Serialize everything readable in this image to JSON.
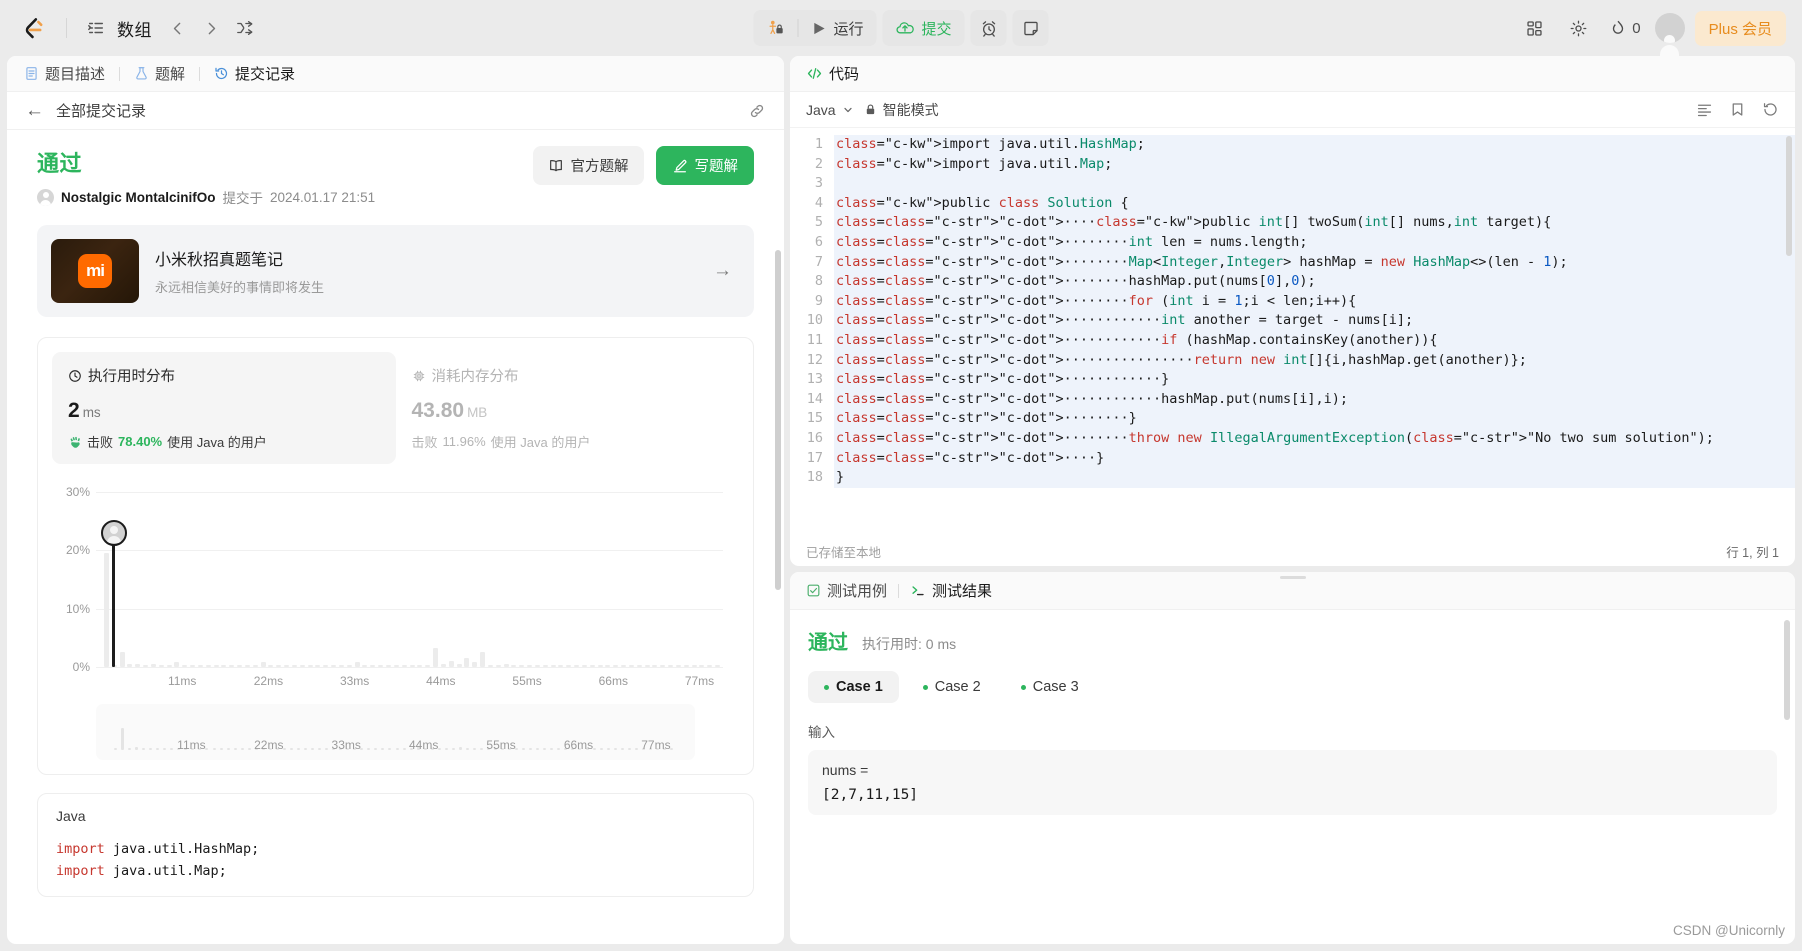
{
  "topbar": {
    "logo_icon": "leetcode-logo-icon",
    "list_icon": "list-icon",
    "title": "数组",
    "prev_icon": "chevron-left-icon",
    "next_icon": "chevron-right-icon",
    "shuffle_icon": "shuffle-icon",
    "debug_icon": "debug-lock-icon",
    "run_icon": "play-icon",
    "run_label": "运行",
    "submit_icon": "cloud-upload-icon",
    "submit_label": "提交",
    "timer_icon": "alarm-clock-icon",
    "note_icon": "note-icon",
    "apps_icon": "grid-apps-icon",
    "settings_icon": "gear-icon",
    "streak_icon": "flame-icon",
    "streak_count": "0",
    "avatar": "user-avatar",
    "plus_label": "Plus 会员"
  },
  "left_panel": {
    "tabs": [
      {
        "label": "题目描述",
        "icon": "document-icon",
        "active": false
      },
      {
        "label": "题解",
        "icon": "flask-icon",
        "active": false
      },
      {
        "label": "提交记录",
        "icon": "history-icon",
        "active": true
      }
    ],
    "back_label": "全部提交记录",
    "back_icon": "arrow-left-icon",
    "link_icon": "link-icon",
    "submission": {
      "verdict": "通过",
      "user": "Nostalgic MontalcinifOo",
      "submitted_prefix": "提交于",
      "timestamp": "2024.01.17 21:51",
      "official_solution_label": "官方题解",
      "official_solution_icon": "book-icon",
      "write_solution_label": "写题解",
      "write_solution_icon": "pencil-icon"
    },
    "ad": {
      "logo_text": "mi",
      "title": "小米秋招真题笔记",
      "subtitle": "永远相信美好的事情即将发生",
      "arrow_icon": "arrow-right-icon"
    },
    "stats": {
      "runtime": {
        "icon": "clock-icon",
        "title": "执行用时分布",
        "value": "2",
        "unit": "ms",
        "beat_icon": "hand-clap-icon",
        "beat_prefix": "击败",
        "beat_pct": "78.40%",
        "beat_suffix": "使用 Java 的用户"
      },
      "memory": {
        "icon": "chip-icon",
        "title": "消耗内存分布",
        "value": "43.80",
        "unit": "MB",
        "beat_prefix": "击败",
        "beat_pct": "11.96%",
        "beat_suffix": "使用 Java 的用户"
      }
    },
    "code_card": {
      "lang": "Java",
      "lines": [
        "import java.util.HashMap;",
        "import java.util.Map;"
      ]
    }
  },
  "chart_data": {
    "type": "bar",
    "title": "执行用时分布",
    "xlabel": "",
    "ylabel": "",
    "ylim": [
      0,
      30
    ],
    "yticks": [
      "0%",
      "10%",
      "20%",
      "30%"
    ],
    "ytick_values": [
      0,
      10,
      20,
      30
    ],
    "xticks": [
      "11ms",
      "22ms",
      "33ms",
      "44ms",
      "55ms",
      "66ms",
      "77ms"
    ],
    "xtick_values": [
      11,
      22,
      33,
      44,
      55,
      66,
      77
    ],
    "grid": true,
    "legend": "none",
    "marker": {
      "x": 2,
      "y": 24.5,
      "label": "2 ms",
      "beat": "78.40%"
    },
    "categories": [
      1,
      2,
      3,
      4,
      5,
      6,
      7,
      8,
      9,
      10,
      11,
      12,
      13,
      14,
      15,
      16,
      17,
      18,
      19,
      20,
      21,
      22,
      23,
      24,
      25,
      26,
      27,
      28,
      29,
      30,
      31,
      32,
      33,
      34,
      35,
      36,
      37,
      38,
      39,
      40,
      41,
      42,
      43,
      44,
      45,
      46,
      47,
      48,
      49,
      50,
      51,
      52,
      53,
      54,
      55,
      56,
      57,
      58,
      59,
      60,
      61,
      62,
      63,
      64,
      65,
      66,
      67,
      68,
      69,
      70,
      71,
      72,
      73,
      74,
      75,
      76,
      77,
      78,
      79,
      80
    ],
    "values": [
      0,
      19.5,
      0.3,
      2.6,
      0.5,
      0.6,
      0.4,
      0.5,
      0.4,
      0.4,
      0.9,
      0.4,
      0.3,
      0.3,
      0.3,
      0.3,
      0.3,
      0.3,
      0.3,
      0.3,
      0.3,
      0.9,
      0.3,
      0.3,
      0.3,
      0.3,
      0.3,
      0.3,
      0.3,
      0.3,
      0.3,
      0.3,
      0.3,
      0.9,
      0.3,
      0.3,
      0.3,
      0.3,
      0.3,
      0.3,
      0.3,
      0.3,
      0.3,
      3.3,
      0.6,
      1.0,
      0.5,
      1.6,
      0.8,
      2.6,
      0.4,
      0.4,
      0.5,
      0.3,
      0.4,
      0.3,
      0.3,
      0.3,
      0.3,
      0.3,
      0.3,
      0.3,
      0.3,
      0.3,
      0.3,
      0.3,
      0.3,
      0.3,
      0.3,
      0.3,
      0.3,
      0.3,
      0.3,
      0.3,
      0.3,
      0.3,
      0.3,
      0.3,
      0.3,
      0.3
    ],
    "minimap_labels": [
      "11ms",
      "22ms",
      "33ms",
      "44ms",
      "55ms",
      "66ms",
      "77ms"
    ]
  },
  "code_panel": {
    "head_icon": "code-tag-icon",
    "head_title": "代码",
    "language": "Java",
    "chevron_icon": "chevron-down-icon",
    "lock_icon": "lock-icon",
    "mode_label": "智能模式",
    "format_icon": "format-lines-icon",
    "bookmark_icon": "bookmark-icon",
    "reset_icon": "reset-icon",
    "status": "已存储至本地",
    "cursor": "行 1, 列 1",
    "code_lines": [
      "import java.util.HashMap;",
      "import java.util.Map;",
      "",
      "public class Solution {",
      "    public int[] twoSum(int[] nums,int target){",
      "        int len = nums.length;",
      "        Map<Integer,Integer> hashMap = new HashMap<>(len - 1);",
      "        hashMap.put(nums[0],0);",
      "        for (int i = 1;i < len;i++){",
      "            int another = target - nums[i];",
      "            if (hashMap.containsKey(another)){",
      "                return new int[]{i,hashMap.get(another)};",
      "            }",
      "            hashMap.put(nums[i],i);",
      "        }",
      "        throw new IllegalArgumentException(\"No two sum solution\");",
      "    }",
      "}"
    ],
    "line_numbers": [
      "1",
      "2",
      "3",
      "4",
      "5",
      "6",
      "7",
      "8",
      "9",
      "10",
      "11",
      "12",
      "13",
      "14",
      "15",
      "16",
      "17",
      "18"
    ]
  },
  "test_panel": {
    "tabs": [
      {
        "label": "测试用例",
        "icon": "checkbox-icon",
        "active": false
      },
      {
        "label": "测试结果",
        "icon": "terminal-icon",
        "active": true
      }
    ],
    "result_verdict": "通过",
    "result_time": "执行用时: 0 ms",
    "cases": [
      {
        "label": "Case 1",
        "active": true
      },
      {
        "label": "Case 2",
        "active": false
      },
      {
        "label": "Case 3",
        "active": false
      }
    ],
    "input_label": "输入",
    "input_name": "nums =",
    "input_value": "[2,7,11,15]"
  },
  "watermark": "CSDN @Unicornly",
  "colors": {
    "green": "#2db55d",
    "orange": "#e78c1e",
    "plus_bg": "#fbe9cf",
    "page_bg": "#ebebeb"
  }
}
